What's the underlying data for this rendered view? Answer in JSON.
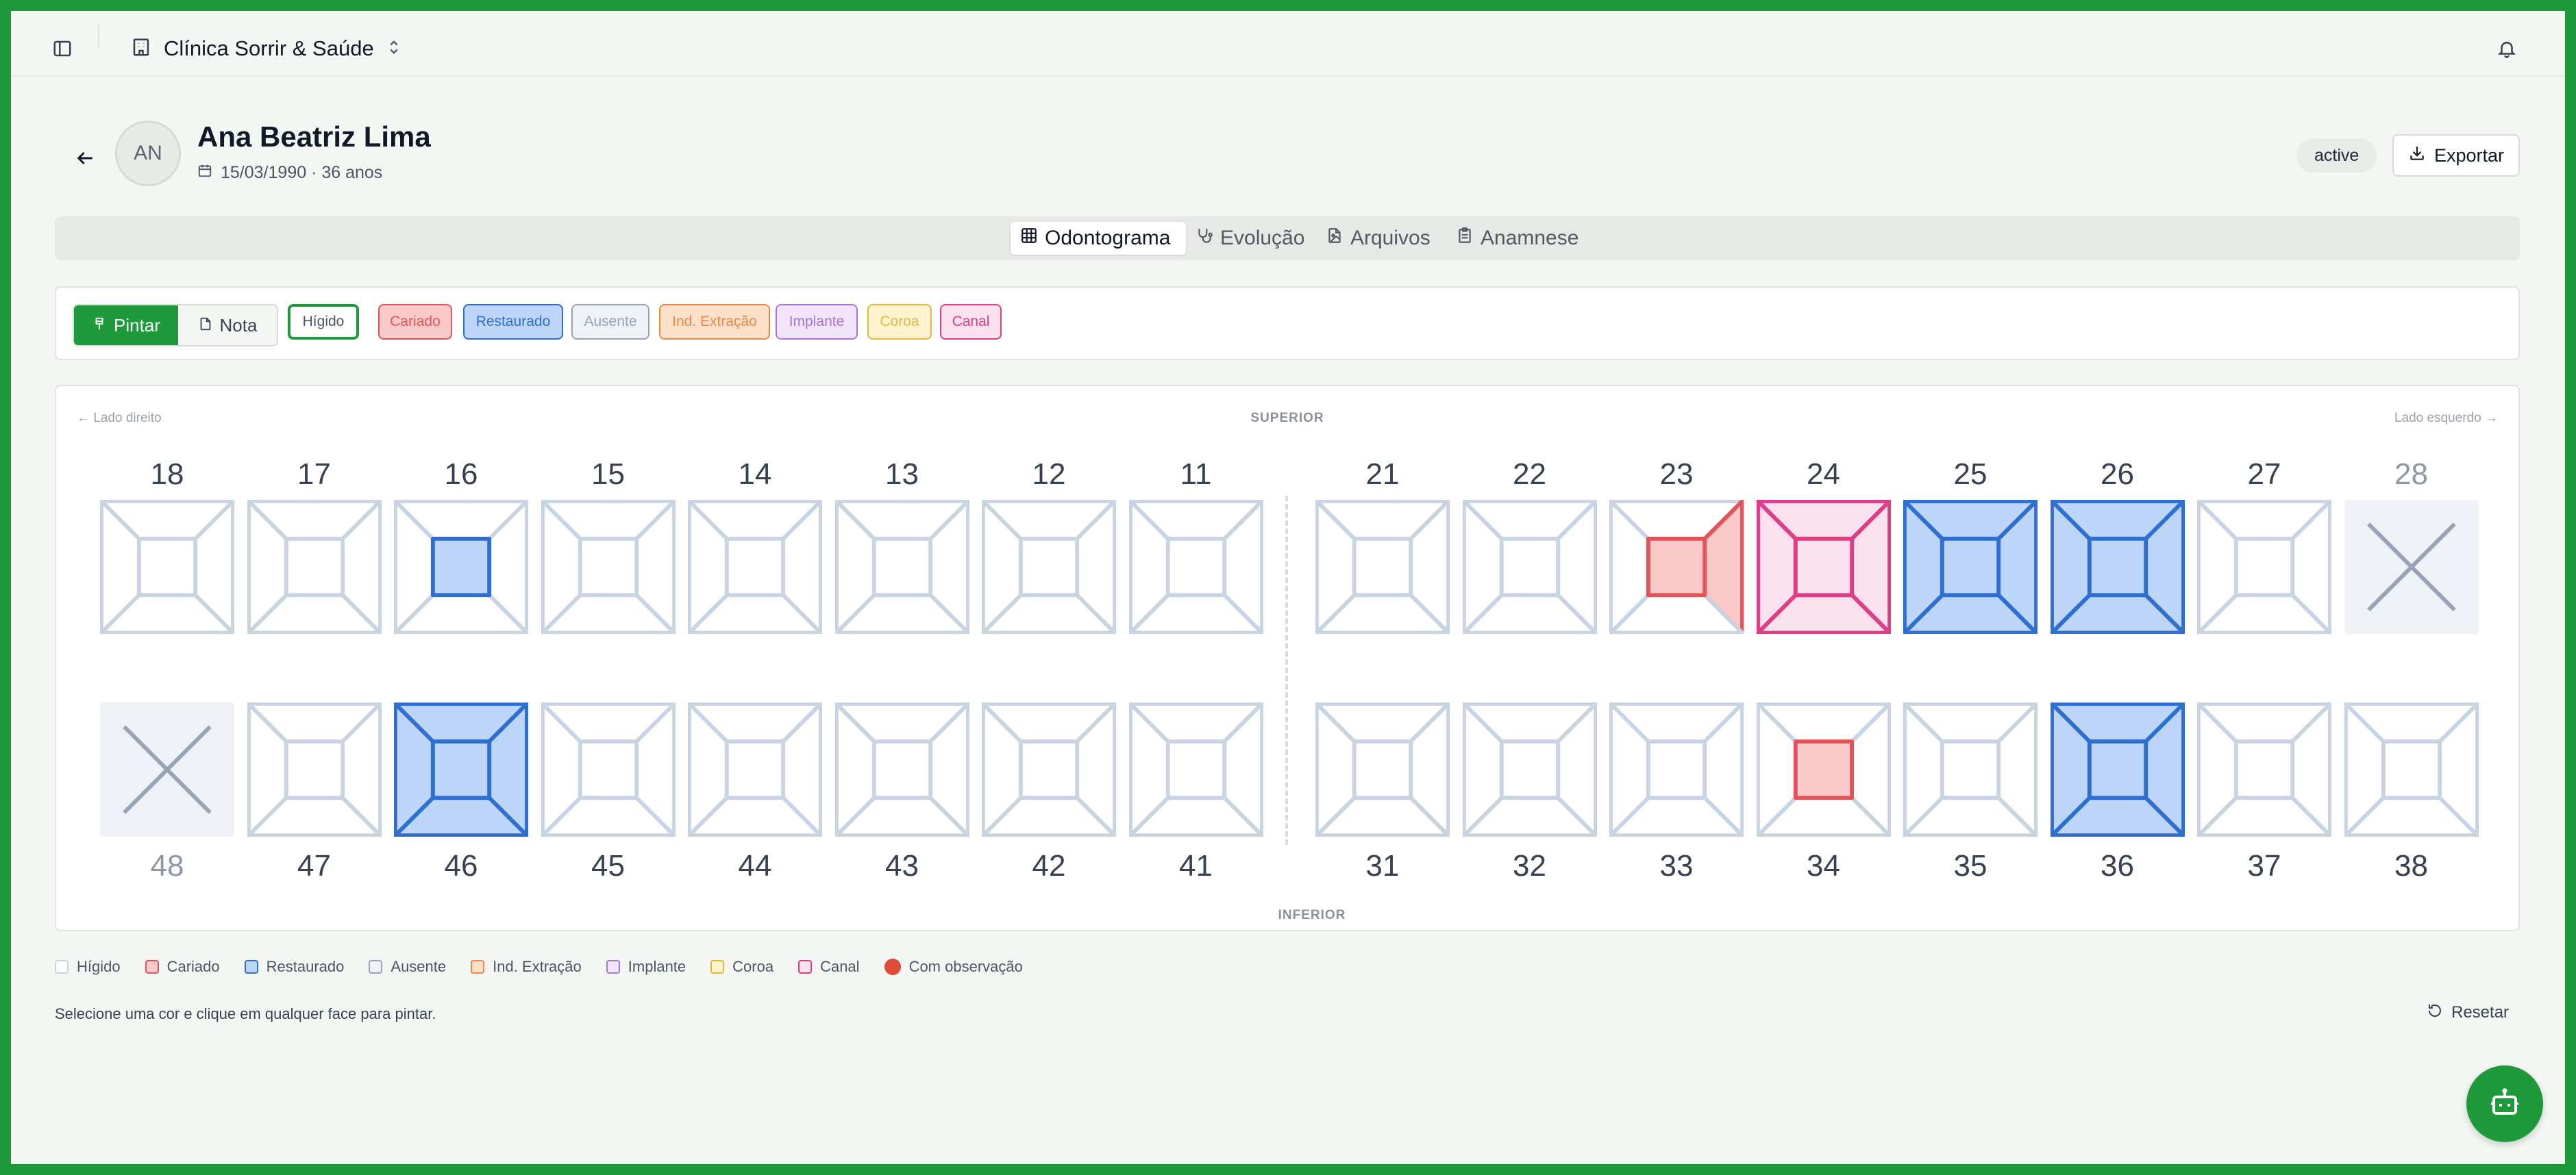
{
  "header": {
    "clinic_name": "Clínica Sorrir & Saúde"
  },
  "patient": {
    "initials": "AN",
    "name": "Ana Beatriz Lima",
    "meta": "15/03/1990 · 36 anos",
    "status": "active",
    "export_label": "Exportar"
  },
  "tabs": [
    {
      "label": "Odontograma",
      "active": true
    },
    {
      "label": "Evolução",
      "active": false
    },
    {
      "label": "Arquivos",
      "active": false
    },
    {
      "label": "Anamnese",
      "active": false
    }
  ],
  "toolbar": {
    "paint_label": "Pintar",
    "note_label": "Nota",
    "conditions": [
      {
        "key": "higido",
        "label": "Hígido",
        "selected": true
      },
      {
        "key": "cariado",
        "label": "Cariado"
      },
      {
        "key": "restaurado",
        "label": "Restaurado"
      },
      {
        "key": "ausente",
        "label": "Ausente"
      },
      {
        "key": "extracao",
        "label": "Ind. Extração"
      },
      {
        "key": "implante",
        "label": "Implante"
      },
      {
        "key": "coroa",
        "label": "Coroa"
      },
      {
        "key": "canal",
        "label": "Canal"
      }
    ]
  },
  "colors": {
    "accent": "#1e9a3a",
    "higido": {
      "stroke": "#c9d4e3",
      "fill": "#ffffff"
    },
    "cariado": {
      "stroke": "#e2545a",
      "fill": "#fcc9c9"
    },
    "restaurado": {
      "stroke": "#2f6fd1",
      "fill": "#bcd5f8"
    },
    "ausente": {
      "stroke": "#98a3b5",
      "fill": "#eef1f6"
    },
    "extracao": {
      "stroke": "#e8884a",
      "fill": "#fde0c8"
    },
    "implante": {
      "stroke": "#a774d8",
      "fill": "#f1e4fb"
    },
    "coroa": {
      "stroke": "#e0b93a",
      "fill": "#fdf4cf"
    },
    "canal": {
      "stroke": "#df3d86",
      "fill": "#fbe0ee"
    }
  },
  "odontogram": {
    "label_right": "← Lado direito",
    "label_left": "Lado esquerdo →",
    "upper_label": "SUPERIOR",
    "lower_label": "INFERIOR",
    "upper": [
      {
        "number": "18"
      },
      {
        "number": "17"
      },
      {
        "number": "16",
        "faces": {
          "center": "restaurado"
        }
      },
      {
        "number": "15"
      },
      {
        "number": "14"
      },
      {
        "number": "13"
      },
      {
        "number": "12"
      },
      {
        "number": "11"
      },
      {
        "number": "21"
      },
      {
        "number": "22"
      },
      {
        "number": "23",
        "faces": {
          "center": "cariado",
          "right": "cariado"
        }
      },
      {
        "number": "24",
        "whole": "canal"
      },
      {
        "number": "25",
        "whole": "restaurado"
      },
      {
        "number": "26",
        "whole": "restaurado"
      },
      {
        "number": "27"
      },
      {
        "number": "28",
        "missing": true
      }
    ],
    "lower": [
      {
        "number": "48",
        "missing": true
      },
      {
        "number": "47"
      },
      {
        "number": "46",
        "whole": "restaurado"
      },
      {
        "number": "45"
      },
      {
        "number": "44"
      },
      {
        "number": "43"
      },
      {
        "number": "42"
      },
      {
        "number": "41"
      },
      {
        "number": "31"
      },
      {
        "number": "32"
      },
      {
        "number": "33"
      },
      {
        "number": "34",
        "faces": {
          "center": "cariado"
        }
      },
      {
        "number": "35"
      },
      {
        "number": "36",
        "whole": "restaurado"
      },
      {
        "number": "37"
      },
      {
        "number": "38"
      }
    ]
  },
  "legend": [
    {
      "key": "higido",
      "label": "Hígido"
    },
    {
      "key": "cariado",
      "label": "Cariado"
    },
    {
      "key": "restaurado",
      "label": "Restaurado"
    },
    {
      "key": "ausente",
      "label": "Ausente"
    },
    {
      "key": "extracao",
      "label": "Ind. Extração"
    },
    {
      "key": "implante",
      "label": "Implante"
    },
    {
      "key": "coroa",
      "label": "Coroa"
    },
    {
      "key": "canal",
      "label": "Canal"
    },
    {
      "key": "observacao",
      "label": "Com observação",
      "dot": true
    }
  ],
  "hint": "Selecione uma cor e clique em qualquer face para pintar.",
  "reset_label": "Resetar"
}
